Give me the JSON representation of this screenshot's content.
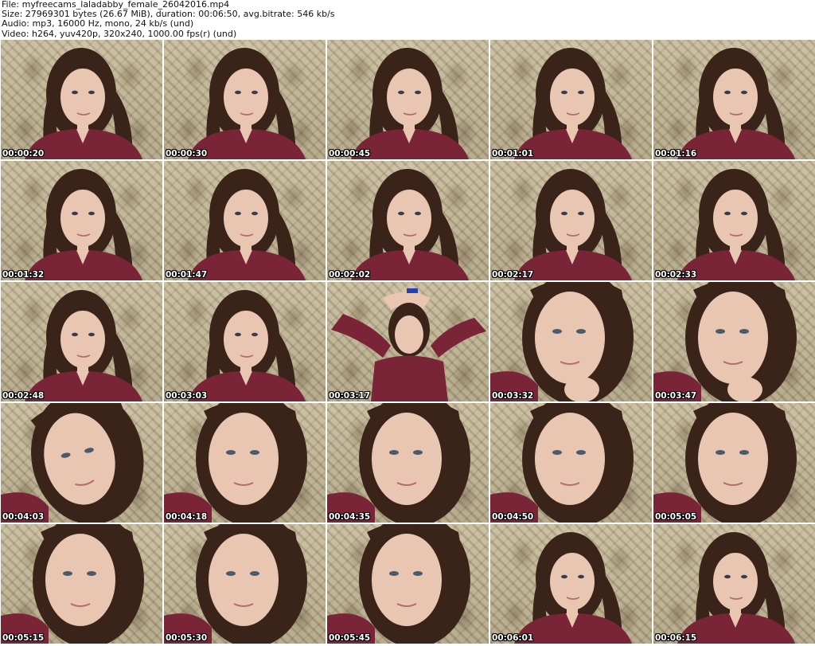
{
  "header": {
    "file": "File: myfreecams_laladabby_female_26042016.mp4",
    "size": "Size: 27969301 bytes (26.67 MiB), duration: 00:06:50, avg.bitrate: 546 kb/s",
    "audio": "Audio: mp3, 16000 Hz, mono, 24 kb/s (und)",
    "video": "Video: h264, yuv420p, 320x240, 1000.00 fps(r) (und)"
  },
  "thumbnails": [
    {
      "timestamp": "00:00:20",
      "pose": "center"
    },
    {
      "timestamp": "00:00:30",
      "pose": "center"
    },
    {
      "timestamp": "00:00:45",
      "pose": "center"
    },
    {
      "timestamp": "00:01:01",
      "pose": "center"
    },
    {
      "timestamp": "00:01:16",
      "pose": "center"
    },
    {
      "timestamp": "00:01:32",
      "pose": "center"
    },
    {
      "timestamp": "00:01:47",
      "pose": "center"
    },
    {
      "timestamp": "00:02:02",
      "pose": "center"
    },
    {
      "timestamp": "00:02:17",
      "pose": "center"
    },
    {
      "timestamp": "00:02:33",
      "pose": "center"
    },
    {
      "timestamp": "00:02:48",
      "pose": "center"
    },
    {
      "timestamp": "00:03:03",
      "pose": "center"
    },
    {
      "timestamp": "00:03:17",
      "pose": "arms-up"
    },
    {
      "timestamp": "00:03:32",
      "pose": "close-chin"
    },
    {
      "timestamp": "00:03:47",
      "pose": "close-chin"
    },
    {
      "timestamp": "00:04:03",
      "pose": "close-tilt"
    },
    {
      "timestamp": "00:04:18",
      "pose": "close"
    },
    {
      "timestamp": "00:04:35",
      "pose": "close"
    },
    {
      "timestamp": "00:04:50",
      "pose": "close"
    },
    {
      "timestamp": "00:05:05",
      "pose": "close"
    },
    {
      "timestamp": "00:05:15",
      "pose": "close"
    },
    {
      "timestamp": "00:05:30",
      "pose": "close"
    },
    {
      "timestamp": "00:05:45",
      "pose": "close"
    },
    {
      "timestamp": "00:06:01",
      "pose": "center"
    },
    {
      "timestamp": "00:06:15",
      "pose": "center"
    }
  ],
  "colors": {
    "shirt": "#7a2438",
    "hair": "#3a2419",
    "skin": "#e8c6b2",
    "wallpaper": "#b9ad8e"
  }
}
